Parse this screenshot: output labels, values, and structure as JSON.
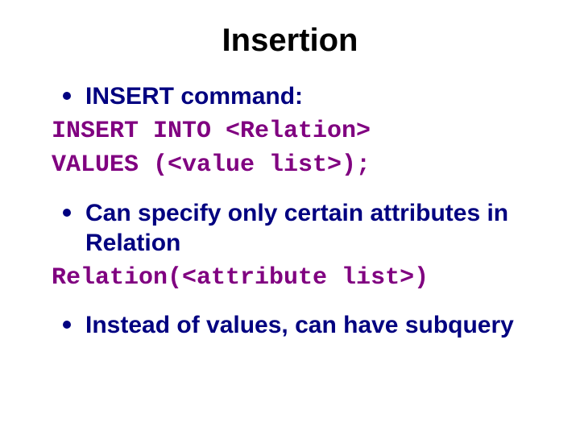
{
  "title": "Insertion",
  "bullets": {
    "b1": "INSERT command:",
    "b2": "Can specify only certain attributes in Relation",
    "b3": "Instead of values, can have subquery"
  },
  "code": {
    "c1a": "INSERT INTO <Relation>",
    "c1b": "VALUES (<value list>);",
    "c2": "Relation(<attribute list>)"
  },
  "colors": {
    "title": "#000000",
    "bullet": "#000080",
    "code": "#800080"
  }
}
